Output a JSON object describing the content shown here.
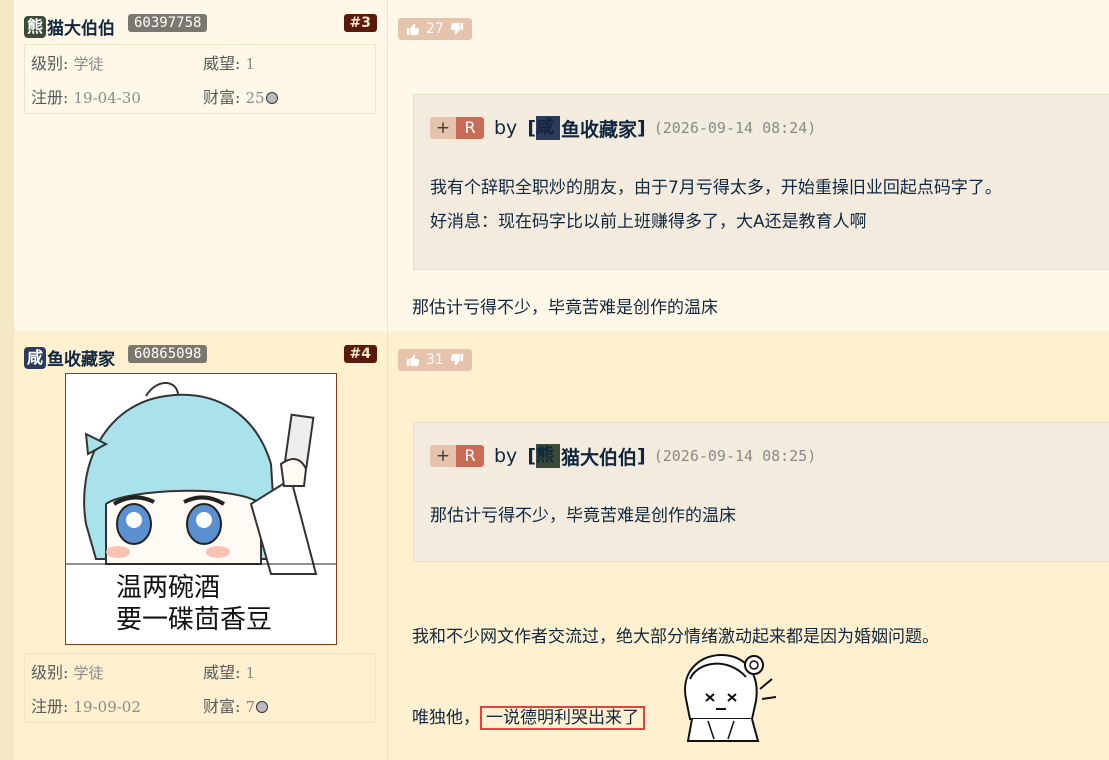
{
  "posts": [
    {
      "floor": "#3",
      "user": {
        "icon_char": "熊",
        "name": "猫大伯伯",
        "id": "60397758"
      },
      "stats": {
        "level_label": "级别:",
        "level": "学徒",
        "prestige_label": "威望:",
        "prestige": "1",
        "reg_label": "注册:",
        "reg": "19-04-30",
        "wealth_label": "财富:",
        "wealth": "25"
      },
      "votes": "27",
      "quote": {
        "plus": "+",
        "r": "R",
        "by": "by",
        "bracket_open": "[",
        "author_icon": "咸",
        "author": "鱼收藏家",
        "bracket_close": "]",
        "time": "(2026-09-14 08:24)",
        "lines": [
          "我有个辞职全职炒的朋友，由于7月亏得太多，开始重操旧业回起点码字了。",
          "好消息：现在码字比以前上班赚得多了，大A还是教育人啊"
        ]
      },
      "text": "那估计亏得不少，毕竟苦难是创作的温床"
    },
    {
      "floor": "#4",
      "user": {
        "icon_char": "咸",
        "name": "鱼收藏家",
        "id": "60865098"
      },
      "avatar_caption": [
        "温两碗酒",
        "要一碟茴香豆"
      ],
      "stats": {
        "level_label": "级别:",
        "level": "学徒",
        "prestige_label": "威望:",
        "prestige": "1",
        "reg_label": "注册:",
        "reg": "19-09-02",
        "wealth_label": "财富:",
        "wealth": "7"
      },
      "votes": "31",
      "quote": {
        "plus": "+",
        "r": "R",
        "by": "by",
        "bracket_open": "[",
        "author_icon": "熊",
        "author": "猫大伯伯",
        "bracket_close": "]",
        "time": "(2026-09-14 08:25)",
        "lines": [
          "那估计亏得不少，毕竟苦难是创作的温床"
        ]
      },
      "text1": "我和不少网文作者交流过，绝大部分情绪激动起来都是因为婚姻问题。",
      "text2_prefix": "唯独他，",
      "text2_highlight": "一说德明利哭出来了"
    }
  ]
}
